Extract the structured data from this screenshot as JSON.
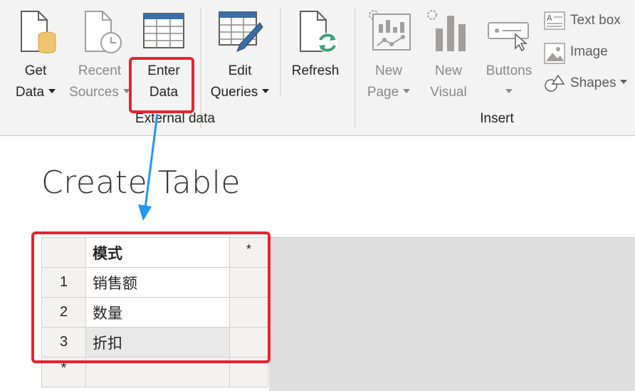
{
  "ribbon": {
    "get_data": {
      "line1": "Get",
      "line2": "Data"
    },
    "recent_sources": {
      "line1": "Recent",
      "line2": "Sources"
    },
    "enter_data": {
      "line1": "Enter",
      "line2": "Data"
    },
    "edit_queries": {
      "line1": "Edit",
      "line2": "Queries"
    },
    "refresh": {
      "label": "Refresh"
    },
    "new_page": {
      "line1": "New",
      "line2": "Page"
    },
    "new_visual": {
      "line1": "New",
      "line2": "Visual"
    },
    "buttons": {
      "label": "Buttons"
    },
    "text_box": {
      "label": "Text box"
    },
    "image": {
      "label": "Image"
    },
    "shapes": {
      "label": "Shapes"
    },
    "group_external": "External data",
    "group_insert": "Insert"
  },
  "dialog": {
    "title": "Create Table",
    "column_header": "模式",
    "new_column_marker": "*",
    "new_row_marker": "*",
    "rows": [
      {
        "num": "1",
        "value": "销售额"
      },
      {
        "num": "2",
        "value": "数量"
      },
      {
        "num": "3",
        "value": "折扣"
      }
    ]
  },
  "colors": {
    "highlight": "#e8232e",
    "arrow": "#2196f3"
  }
}
